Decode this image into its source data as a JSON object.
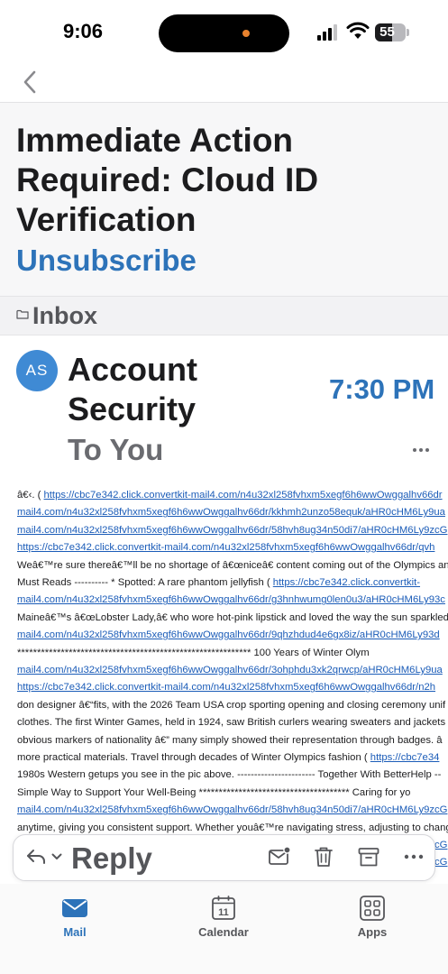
{
  "status_bar": {
    "time": "9:06",
    "battery": "55",
    "battery_level": 0.55
  },
  "email": {
    "subject": "Immediate Action Required: Cloud ID Verification",
    "unsubscribe_label": "Unsubscribe",
    "folder": "Inbox",
    "sender_initials": "AS",
    "sender_name": "Account Security",
    "recipient": "To You",
    "time": "7:30 PM"
  },
  "body_lines": [
    {
      "prefix": "â€‹. ( ",
      "link": "https://cbc7e342.click.convertkit-mail4.com/n4u32xl258fvhxm5xegf6h6wwOwggalhv66dr"
    },
    {
      "prefix": "",
      "link": "mail4.com/n4u32xl258fvhxm5xegf6h6wwOwggalhv66dr/kkhmh2unzo58equk/aHR0cHM6Ly9ua"
    },
    {
      "prefix": "",
      "link": "mail4.com/n4u32xl258fvhxm5xegf6h6wwOwggalhv66dr/58hvh8ug34n50di7/aHR0cHM6Ly9zcG"
    },
    {
      "prefix": "",
      "link": "https://cbc7e342.click.convertkit-mail4.com/n4u32xl258fvhxm5xegf6h6wwOwggalhv66dr/qvh"
    },
    {
      "prefix": "Weâ€™re sure thereâ€™ll be no shortage of â€œniceâ€​ content coming out of the Olympics an",
      "link": ""
    },
    {
      "prefix": "Must Reads ---------- * Spotted: A rare phantom jellyfish ( ",
      "link": "https://cbc7e342.click.convertkit-"
    },
    {
      "prefix": "",
      "link": "mail4.com/n4u32xl258fvhxm5xegf6h6wwOwggalhv66dr/g3hnhwumg0len0u3/aHR0cHM6Ly93c"
    },
    {
      "prefix": "Maineâ€™s â€œLobster Lady,â€​ who wore hot-pink lipstick and loved the way the sun sparkled",
      "link": ""
    },
    {
      "prefix": "",
      "link": "mail4.com/n4u32xl258fvhxm5xegf6h6wwOwggalhv66dr/9qhzhdud4e6gx8iz/aHR0cHM6Ly93d"
    },
    {
      "prefix": "*********************************************************** 100 Years of Winter Olym",
      "link": ""
    },
    {
      "prefix": "",
      "link": "mail4.com/n4u32xl258fvhxm5xegf6h6wwOwggalhv66dr/3ohphdu3xk2qrwcp/aHR0cHM6Ly9ua"
    },
    {
      "prefix": "",
      "link": "https://cbc7e342.click.convertkit-mail4.com/n4u32xl258fvhxm5xegf6h6wwOwggalhv66dr/n2h"
    },
    {
      "prefix": "don designer â€“fits, with the 2026 Team USA crop sporting opening and closing ceremony unif",
      "link": ""
    },
    {
      "prefix": "clothes. The first Winter Games, held in 1924, saw British curlers wearing sweaters and jackets",
      "link": ""
    },
    {
      "prefix": "obvious markers of nationality â€” many simply showed their representation through badges. â",
      "link": ""
    },
    {
      "prefix": "more practical materials. Travel through decades of Winter Olympics fashion ( ",
      "link": "https://cbc7e34"
    },
    {
      "prefix": "1980s Western getups you see in the pic above. ----------------------- Together With BetterHelp --",
      "link": ""
    },
    {
      "prefix": "Simple Way to Support Your Well-Being ************************************** Caring for yo",
      "link": ""
    },
    {
      "prefix": "",
      "link": "mail4.com/n4u32xl258fvhxm5xegf6h6wwOwggalhv66dr/58hvh8ug34n50di7/aHR0cHM6Ly9zcG"
    },
    {
      "prefix": "anytime, giving you consistent support. Whether youâ€™re navigating stress, adjusting to chang",
      "link": ""
    },
    {
      "prefix": "",
      "link": "mail4.com/n4u32xl258fvhxm5xegf6h6wwOwggalhv66dr/58hvh8ug34n50di7/aHR0cHM6Ly9zcG"
    },
    {
      "prefix": "",
      "link": "mail4.com/n4u32xl258fvhxm5xegf6h6wwOwggalhv66dr/58hvh8ug34n50di7/aHR0cHM6Ly9zcG"
    }
  ],
  "action_bar": {
    "reply_label": "Reply"
  },
  "tabs": [
    {
      "label": "Mail",
      "icon": "mail-icon",
      "active": true
    },
    {
      "label": "Calendar",
      "icon": "calendar-icon",
      "active": false,
      "icon_text": "11"
    },
    {
      "label": "Apps",
      "icon": "apps-icon",
      "active": false
    }
  ],
  "colors": {
    "accent": "#2d73b9",
    "link": "#1b5cb8",
    "avatar": "#3f8ad4",
    "notification_dot": "#e8822e"
  }
}
